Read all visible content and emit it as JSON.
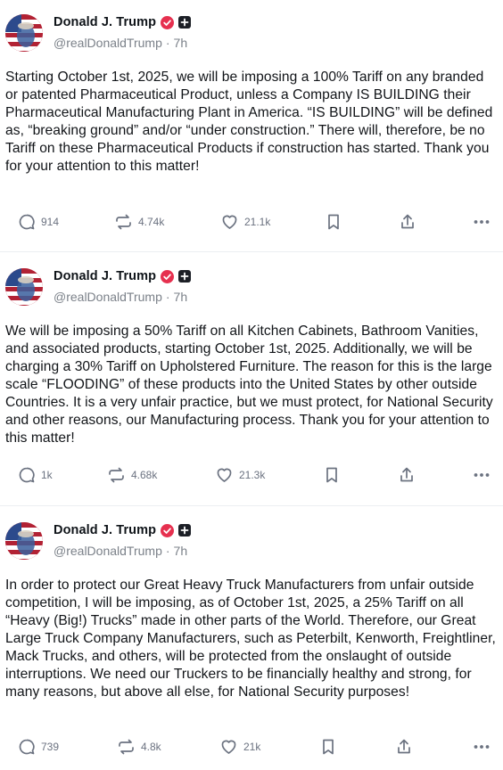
{
  "author": {
    "display_name": "Donald J. Trump",
    "handle": "@realDonaldTrump",
    "separator": "·"
  },
  "colors": {
    "verified": "#e6304f",
    "muted": "#6b7280",
    "text": "#111418"
  },
  "posts": [
    {
      "time": "7h",
      "text": "Starting October 1st, 2025, we will be imposing a 100% Tariff on any branded or patented Pharmaceutical Product, unless a Company IS BUILDING their Pharmaceutical Manufacturing Plant in America. “IS BUILDING” will be defined as, “breaking ground” and/or “under construction.” There will, therefore, be no Tariff on these Pharmaceutical Products if construction has started. Thank you for your attention to this matter!",
      "replies": "914",
      "retruths": "4.74k",
      "likes": "21.1k"
    },
    {
      "time": "7h",
      "text": "We will be imposing a 50% Tariff on all Kitchen Cabinets, Bathroom Vanities, and associated products, starting October 1st, 2025. Additionally, we will be charging a 30% Tariff on Upholstered Furniture. The reason for this is the large scale “FLOODING” of these products into the United States by other outside Countries. It is a very unfair practice, but we must protect, for National Security and other reasons, our Manufacturing process. Thank you for your attention to this matter!",
      "replies": "1k",
      "retruths": "4.68k",
      "likes": "21.3k"
    },
    {
      "time": "7h",
      "text": "In order to protect our Great Heavy Truck Manufacturers from unfair outside competition, I will be imposing, as of October 1st, 2025, a 25% Tariff on all “Heavy (Big!) Trucks” made in other parts of the World. Therefore, our Great Large Truck Company Manufacturers, such as Peterbilt, Kenworth, Freightliner, Mack Trucks, and others, will be protected from the onslaught of outside interruptions. We need our Truckers to be financially healthy and strong, for many reasons, but above all else, for National Security purposes!",
      "replies": "739",
      "retruths": "4.8k",
      "likes": "21k"
    }
  ]
}
